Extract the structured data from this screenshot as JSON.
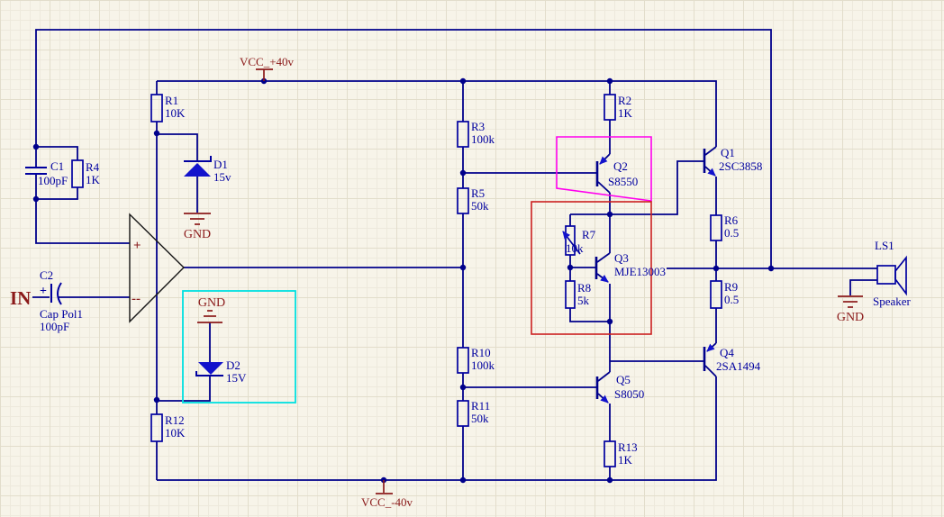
{
  "schematic": {
    "power": {
      "vcc_pos": "VCC_+40v",
      "vcc_neg": "VCC_-40v"
    },
    "grounds": {
      "gnd_d1": "GND",
      "gnd_d2": "GND",
      "gnd_speaker": "GND"
    },
    "input_label": "IN",
    "opamp": {
      "noninv": "+",
      "inv": "--"
    },
    "resistors": {
      "r1": {
        "ref": "R1",
        "value": "10K"
      },
      "r2": {
        "ref": "R2",
        "value": "1K"
      },
      "r3": {
        "ref": "R3",
        "value": "100k"
      },
      "r4": {
        "ref": "R4",
        "value": "1K"
      },
      "r5": {
        "ref": "R5",
        "value": "50k"
      },
      "r6": {
        "ref": "R6",
        "value": "0.5"
      },
      "r7": {
        "ref": "R7",
        "value": "10k"
      },
      "r8": {
        "ref": "R8",
        "value": "5k"
      },
      "r9": {
        "ref": "R9",
        "value": "0.5"
      },
      "r10": {
        "ref": "R10",
        "value": "100k"
      },
      "r11": {
        "ref": "R11",
        "value": "50k"
      },
      "r12": {
        "ref": "R12",
        "value": "10K"
      },
      "r13": {
        "ref": "R13",
        "value": "1K"
      }
    },
    "capacitors": {
      "c1": {
        "ref": "C1",
        "value": "100pF"
      },
      "c2": {
        "ref": "C2",
        "type": "Cap Pol1",
        "value": "100pF",
        "polarity": "+"
      }
    },
    "diodes": {
      "d1": {
        "ref": "D1",
        "value": "15v"
      },
      "d2": {
        "ref": "D2",
        "value": "15V"
      }
    },
    "transistors": {
      "q1": {
        "ref": "Q1",
        "part": "2SC3858"
      },
      "q2": {
        "ref": "Q2",
        "part": "S8550"
      },
      "q3": {
        "ref": "Q3",
        "part": "MJE13003"
      },
      "q4": {
        "ref": "Q4",
        "part": "2SA1494"
      },
      "q5": {
        "ref": "Q5",
        "part": "S8050"
      }
    },
    "speaker": {
      "ref": "LS1",
      "label": "Speaker"
    }
  },
  "colors": {
    "background": "#F7F4E9",
    "wire": "#00008B",
    "component_outline": "#0000A0",
    "component_fill": "#1212CC",
    "power_ground_text": "#8B1A1A",
    "highlight_magenta": "#FF00EE",
    "highlight_red": "#CC2020",
    "highlight_cyan": "#00E0E0"
  }
}
